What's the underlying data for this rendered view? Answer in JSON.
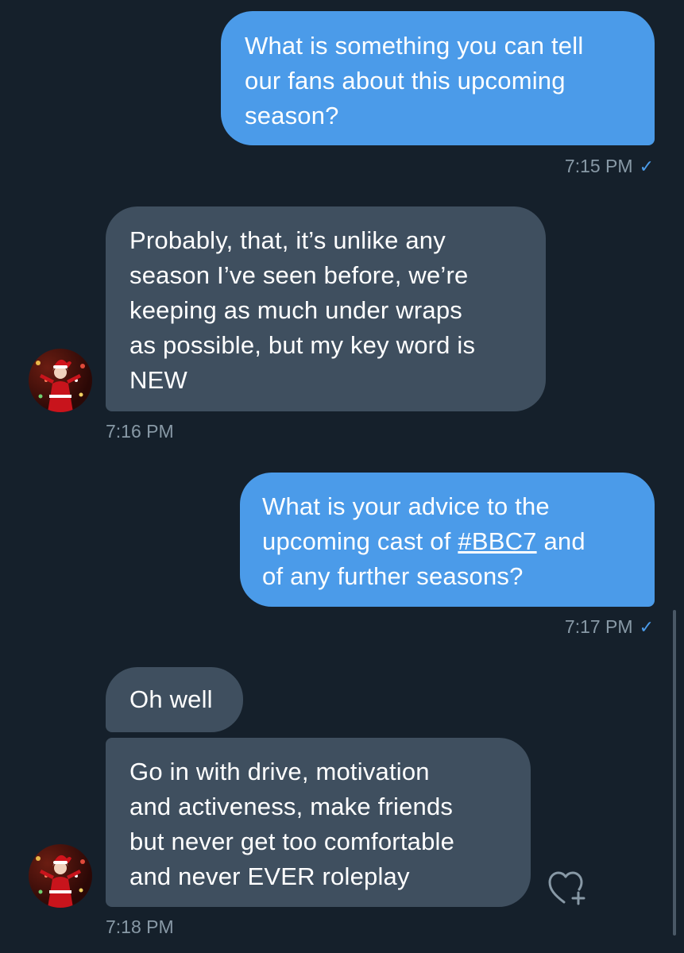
{
  "conversation": {
    "messages": [
      {
        "direction": "sent",
        "lines": [
          "What is something you can tell",
          "our fans about this upcoming",
          "season?"
        ],
        "time": "7:15 PM",
        "read": true
      },
      {
        "direction": "received",
        "lines": [
          "Probably, that, it’s unlike any",
          "season I’ve seen before, we’re",
          "keeping as much under wraps",
          "as possible, but my key word is",
          "NEW"
        ],
        "time": "7:16 PM"
      },
      {
        "direction": "sent",
        "lines": [
          "What is your advice to the",
          "upcoming cast of ",
          "and",
          "of any further seasons?"
        ],
        "hashtag": "#BBC7",
        "time": "7:17 PM",
        "read": true
      },
      {
        "direction": "received",
        "lines": [
          "Oh well"
        ]
      },
      {
        "direction": "received",
        "lines": [
          "Go in with drive, motivation",
          "and activeness, make friends",
          "but never get too comfortable",
          "and never EVER roleplay"
        ],
        "time": "7:18 PM"
      }
    ]
  },
  "icons": {
    "read_receipt": "checkmark-icon",
    "react": "heart-plus-icon",
    "avatar": "santa-avatar"
  },
  "colors": {
    "background": "#15202b",
    "sent_bubble": "#4b9be9",
    "received_bubble": "#3f4f5f",
    "timestamp": "#8899a6"
  }
}
